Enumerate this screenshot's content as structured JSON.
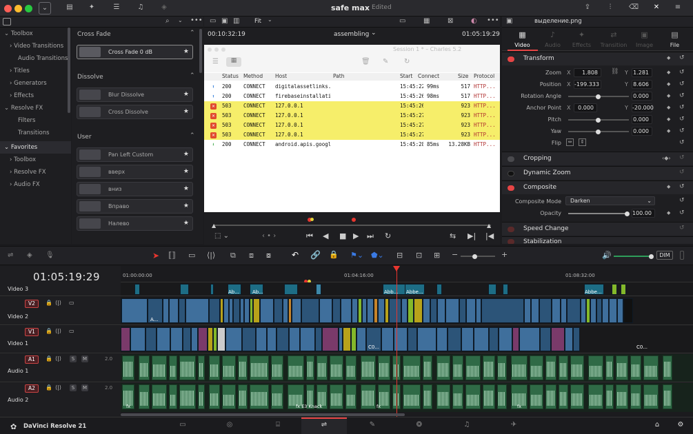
{
  "window": {
    "title": "safe max",
    "status": "Edited"
  },
  "toolbox": {
    "items": [
      "Toolbox",
      "Video Transitions",
      "Audio Transitions",
      "Titles",
      "Generators",
      "Effects",
      "Resolve FX",
      "Filters",
      "Transitions",
      "Favorites",
      "Toolbox",
      "Resolve FX",
      "Audio FX"
    ]
  },
  "effects": {
    "group1": "Cross Fade",
    "g1_items": [
      "Cross Fade 0 dB"
    ],
    "group2": "Dissolve",
    "g2_items": [
      "Blur Dissolve",
      "Cross Dissolve"
    ],
    "group3": "User",
    "g3_items": [
      "Pan Left Custom",
      "вверх",
      "вниз",
      "Вправо",
      "Налево"
    ]
  },
  "viewer": {
    "tc_left": "00:10:32:19",
    "clip_name": "assembling",
    "tc_right": "01:05:19:29",
    "zoom": "Fit"
  },
  "charles": {
    "title": "Session 1 * – Charles 5.2",
    "headers": [
      "Status",
      "Method",
      "Host",
      "Path",
      "Start",
      "Connect",
      "Size",
      "Protocol"
    ],
    "rows": [
      {
        "status": "200",
        "method": "CONNECT",
        "host": "digitalassetlinks.g...",
        "start": "15:45:22",
        "connect": "99ms",
        "size": "517",
        "proto": "HTTP...",
        "kind": "ok"
      },
      {
        "status": "200",
        "method": "CONNECT",
        "host": "firebaseinstallatio...",
        "start": "15:45:26",
        "connect": "98ms",
        "size": "517",
        "proto": "HTTP...",
        "kind": "ok"
      },
      {
        "status": "503",
        "method": "CONNECT",
        "host": "127.0.0.1",
        "start": "15:45:26",
        "connect": "",
        "size": "923",
        "proto": "HTTP...",
        "kind": "err"
      },
      {
        "status": "503",
        "method": "CONNECT",
        "host": "127.0.0.1",
        "start": "15:45:27",
        "connect": "",
        "size": "923",
        "proto": "HTTP...",
        "kind": "err"
      },
      {
        "status": "503",
        "method": "CONNECT",
        "host": "127.0.0.1",
        "start": "15:45:27",
        "connect": "",
        "size": "923",
        "proto": "HTTP...",
        "kind": "err"
      },
      {
        "status": "503",
        "method": "CONNECT",
        "host": "127.0.0.1",
        "start": "15:45:27",
        "connect": "",
        "size": "923",
        "proto": "HTTP...",
        "kind": "err"
      },
      {
        "status": "200",
        "method": "CONNECT",
        "host": "android.apis.googl...",
        "start": "15:45:28",
        "connect": "85ms",
        "size": "13.28KB",
        "proto": "HTTP...",
        "kind": "pending"
      }
    ]
  },
  "inspector": {
    "filename": "выделение.png",
    "tabs": [
      "Video",
      "Audio",
      "Effects",
      "Transition",
      "Image",
      "File"
    ],
    "transform": {
      "title": "Transform",
      "zoom_label": "Zoom",
      "zoom_x": "1.808",
      "zoom_y": "1.281",
      "pos_label": "Position",
      "pos_x": "-199.333",
      "pos_y": "8.606",
      "rot_label": "Rotation Angle",
      "rot": "0.000",
      "anchor_label": "Anchor Point",
      "anchor_x": "0.000",
      "anchor_y": "-20.000",
      "pitch_label": "Pitch",
      "pitch": "0.000",
      "yaw_label": "Yaw",
      "yaw": "0.000",
      "flip_label": "Flip",
      "x": "X",
      "y": "Y"
    },
    "cropping": "Cropping",
    "dynamic_zoom": "Dynamic Zoom",
    "composite": {
      "title": "Composite",
      "mode_label": "Composite Mode",
      "mode": "Darken",
      "opacity_label": "Opacity",
      "opacity": "100.00"
    },
    "speed": "Speed Change",
    "stab": "Stabilization"
  },
  "timeline": {
    "timecode": "01:05:19:29",
    "ruler": [
      "01:00:00:00",
      "01:04:16:00",
      "01:08:32:00"
    ],
    "dim": "DIM",
    "tracks": {
      "v3": "Video 3",
      "v2_id": "V2",
      "v2": "Video 2",
      "v1_id": "V1",
      "v1": "Video 1",
      "a1_id": "A1",
      "a1": "Audio 1",
      "a1_vol": "2.0",
      "a2_id": "A2",
      "a2": "Audio 2",
      "a2_vol": "2.0",
      "s": "S",
      "m": "M"
    },
    "clip_labels": {
      "abb1": "Ab...",
      "abb2": "Ab...",
      "abb3": "Abb...",
      "abb4": "Abbe...",
      "abb5": "Abbe...",
      "a": "A...",
      "c0a": "C0...",
      "c0b": "C0...",
      "fx_a": "fx",
      "fx_b": "fx",
      "fx_c": "fx",
      "kenob": "fx E3 Knack"
    }
  },
  "bottom": {
    "app": "DaVinci Resolve 21"
  },
  "colors": {
    "accent": "#e64545",
    "clip_blue": "#3f6f9c",
    "audio_green": "#2f6a46",
    "playhead": "#e8362f"
  }
}
